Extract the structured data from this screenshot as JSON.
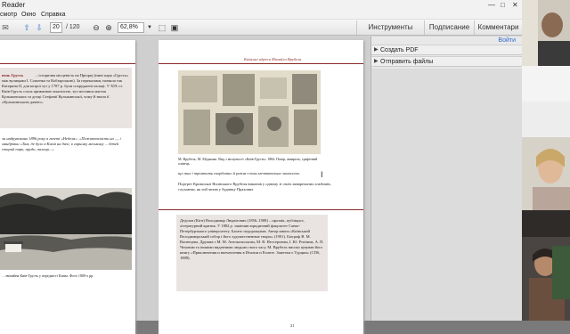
{
  "window": {
    "title": "Reader"
  },
  "menu": {
    "items": [
      "смотр",
      "Окно",
      "Справка"
    ]
  },
  "toolbar": {
    "page_current": "20",
    "page_total": "/ 120",
    "zoom": "62,8%",
    "tabs": [
      "Инструменты",
      "Подписание",
      "Комментари"
    ]
  },
  "side_panel": {
    "link": "Войти",
    "rows": [
      "Создать PDF",
      "Отправить файлы"
    ]
  },
  "doc": {
    "right_header": "Київські адреси Михайла Врубеля",
    "left_head_red": "вень Грусть",
    "left_par1": "– історична місцевість на Пріорці (нині парк «Грусть» між вулицями І. Сошенка та Кобзарською). За переказами, назвала так Катерина ІІ, для котрої тут у 1787 р. були споруджені палаці. У XIX ст. Київ-Грусть стала приватною власністю, тут містився маєток Кульжинських та дочці Стефанії Кульжинської, чому й звали її «Кульжинською дачею».",
    "left_par2": "ла надруковано 1896 року в газеті «Неделя»: «Пожиттєвість на ..., і мандрівки «Там, де було в Києві на дачі, в гарному міському ... дітей старий парк, пруди, палаци...»",
    "left_caption": "…звичайна Київ-Грусть у передмісті Києва. Фото 1880-х рр.",
    "right_caption": "М. Врубель, М. Мурашко. Вид з місцевості «Київ-Грусть» 1884. Папір, акварель, графітний олівець",
    "right_par1": "що тих і тремтить скорботно й разом з тим мечтательно захоплено.",
    "right_par2": "Портрет Кримської Ясинського Врубеля виконав у одному зі своїх акварельних альбомів, слухаючи, як той читав у будинку Прахових",
    "right_note": "Деділов (Кігн) Володимир Людвігович (1856–1908) – прозаїк, публіцист, літературний критик. У 1882 р. закінчив юридичний факультет Санкт-Петербурзького університету. Багато подорожував. Автор книги «Київський Володимирський собор і його художественные творы» (1901). Біограф В. М. Васнецова. Дружив з М. М. Антокольським, М. В. Нестеровим, І. Ю. Рєпіним, А. П. Чеховим та іншими видатними людьми свого часу. М. Врубель високо цінував його книгу «Приключения и впечатления в Италии и Египте. Заметки о Турции» (СПб, 1888).",
    "page_number": "21"
  }
}
